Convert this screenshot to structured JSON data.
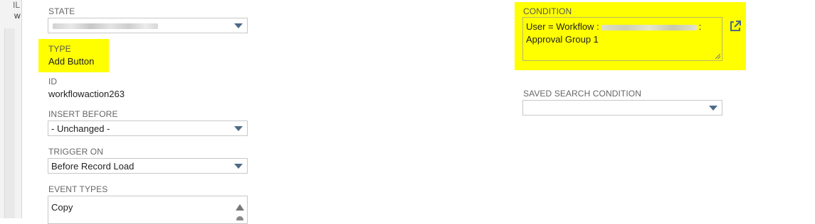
{
  "background": {
    "label": "IL",
    "value": "w"
  },
  "state": {
    "label": "STATE",
    "value_blurred": true
  },
  "type": {
    "label": "TYPE",
    "value": "Add Button"
  },
  "id": {
    "label": "ID",
    "value": "workflowaction263"
  },
  "insert_before": {
    "label": "INSERT BEFORE",
    "value": "- Unchanged -"
  },
  "trigger_on": {
    "label": "TRIGGER ON",
    "value": "Before Record Load"
  },
  "event_types": {
    "label": "EVENT TYPES",
    "items": [
      "Copy"
    ]
  },
  "condition": {
    "label": "CONDITION",
    "line1_prefix": "User = Workflow :",
    "line1_suffix": ":",
    "line2": "Approval Group 1"
  },
  "saved_search_condition": {
    "label": "SAVED SEARCH CONDITION",
    "value": ""
  },
  "colors": {
    "highlight": "#ffff00",
    "caret": "#4e6a86",
    "label_text": "#666666",
    "link_icon": "#4e6a86"
  },
  "icons": {
    "condition_open": "external-link-icon"
  }
}
